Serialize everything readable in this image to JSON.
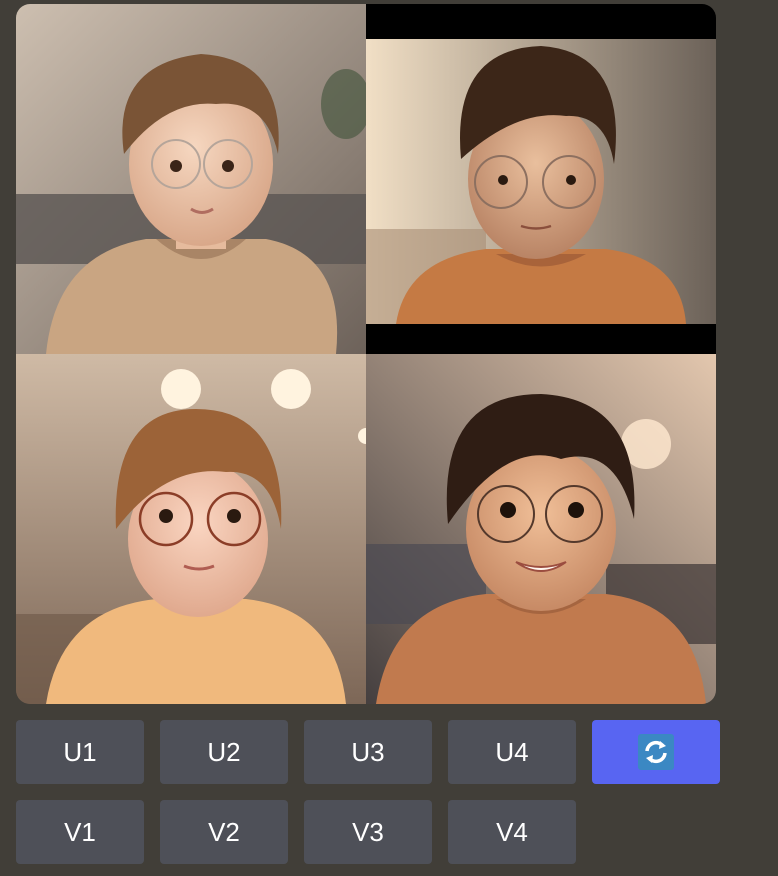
{
  "image_grid": {
    "tiles": [
      {
        "index": 1
      },
      {
        "index": 2
      },
      {
        "index": 3
      },
      {
        "index": 4
      }
    ]
  },
  "buttons": {
    "upscale": [
      "U1",
      "U2",
      "U3",
      "U4"
    ],
    "variation": [
      "V1",
      "V2",
      "V3",
      "V4"
    ],
    "reroll_icon": "reroll-arrows-icon"
  },
  "colors": {
    "background": "#413e38",
    "button": "#4e5058",
    "primary_button": "#5865f2",
    "reroll_icon_bg": "#3b88c3"
  }
}
